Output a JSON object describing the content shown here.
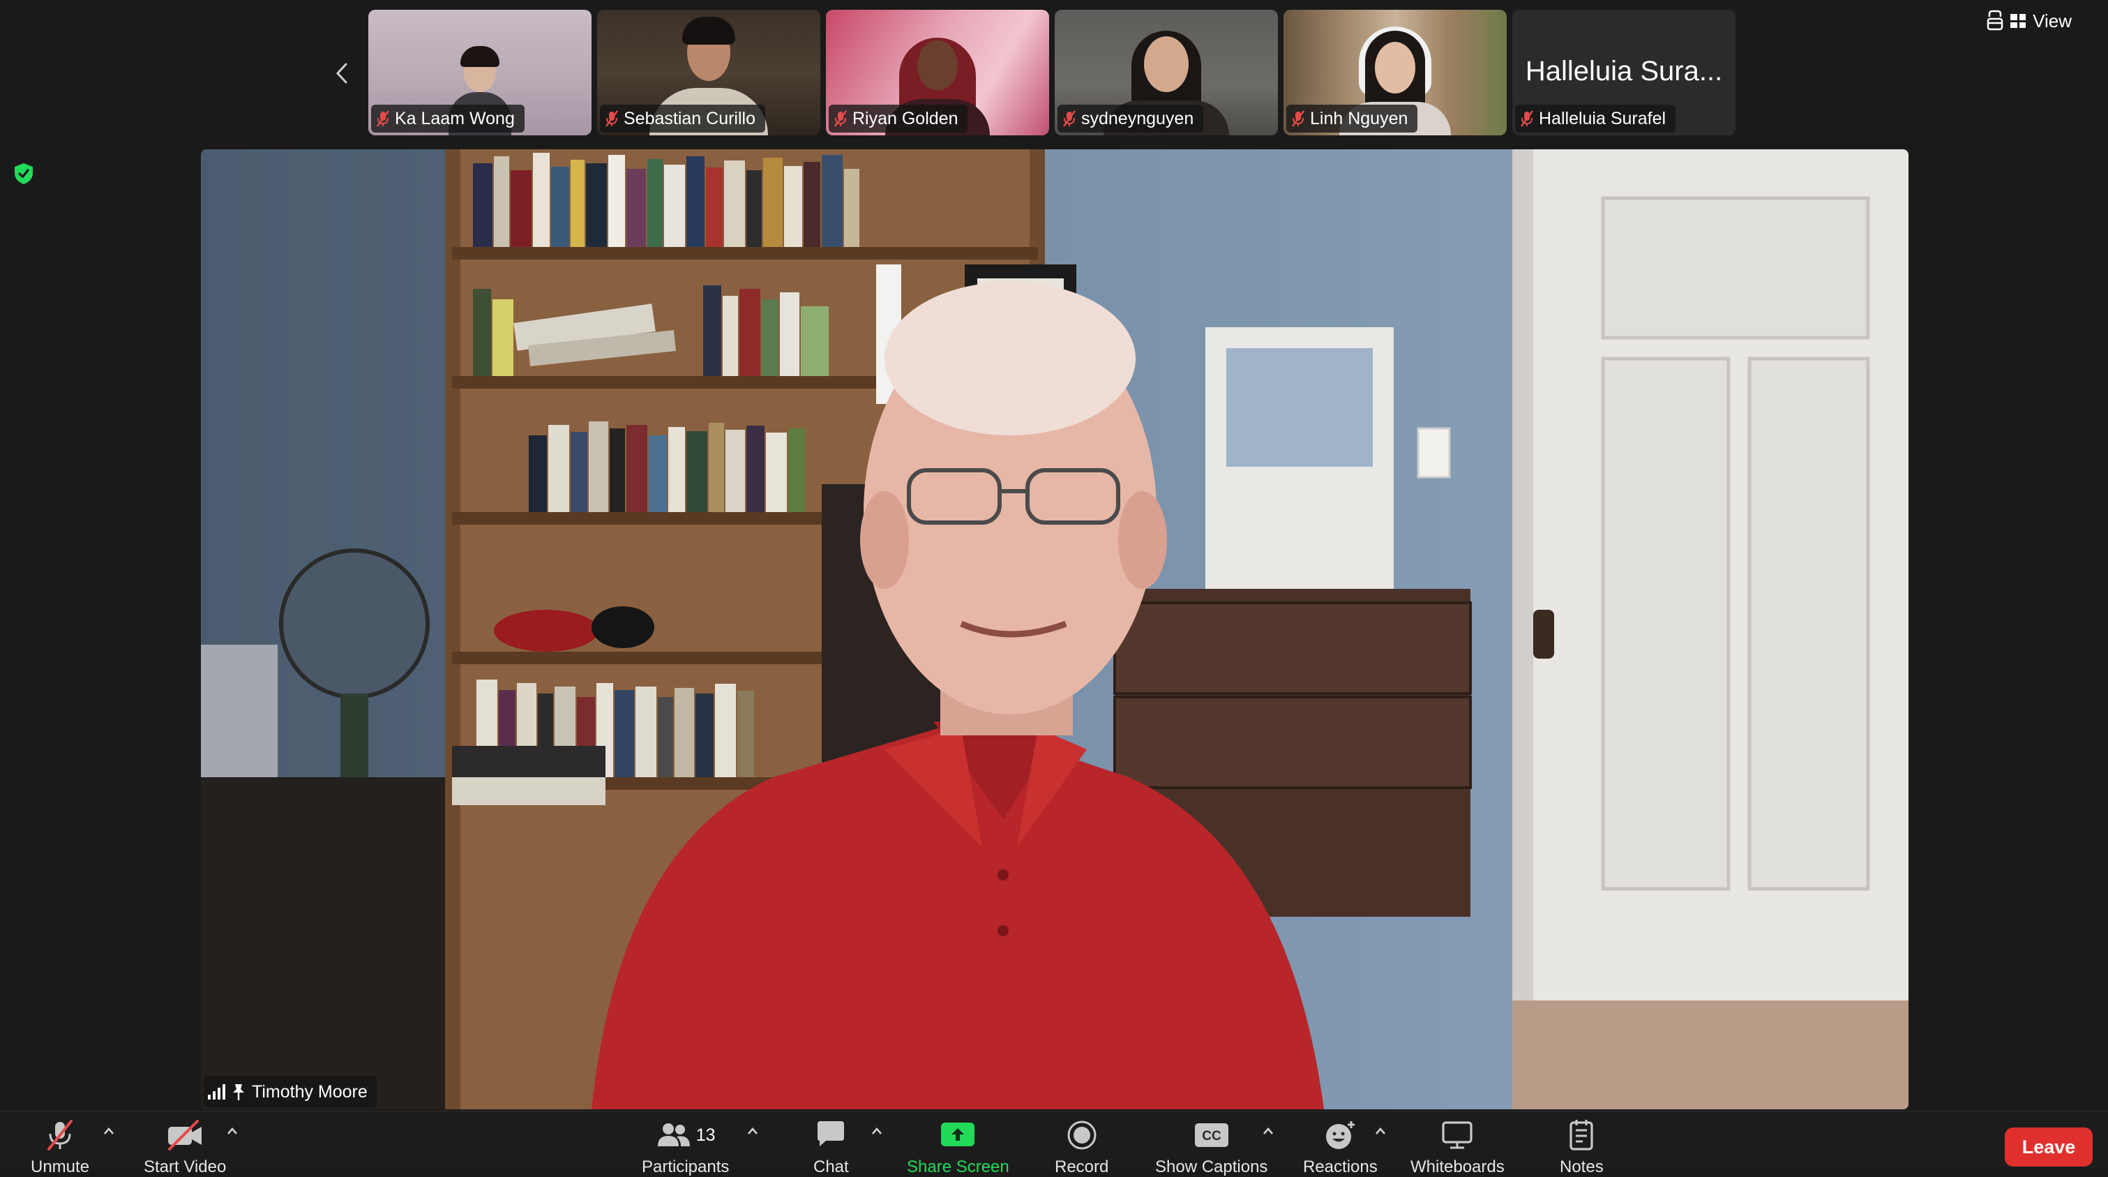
{
  "top_bar": {
    "view_label": "View",
    "view_icon": "view-grid-icon",
    "immersive_icon": "immersive-view-icon"
  },
  "filmstrip": {
    "prev_icon": "chevron-left-icon",
    "participants": [
      {
        "name": "Ka Laam Wong",
        "muted": true
      },
      {
        "name": "Sebastian Curillo",
        "muted": true
      },
      {
        "name": "Riyan Golden",
        "muted": true
      },
      {
        "name": "sydneynguyen",
        "muted": true
      },
      {
        "name": "Linh Nguyen",
        "muted": true
      },
      {
        "name": "Halleluia Surafel",
        "display_title": "Halleluia Sura...",
        "muted": true,
        "video_off": true
      }
    ]
  },
  "security": {
    "icon": "shield-check-icon",
    "color": "#23d959"
  },
  "main_speaker": {
    "name": "Timothy Moore",
    "pinned": true
  },
  "toolbar": {
    "unmute_label": "Unmute",
    "start_video_label": "Start Video",
    "participants_label": "Participants",
    "participants_count": "13",
    "chat_label": "Chat",
    "share_screen_label": "Share Screen",
    "record_label": "Record",
    "show_captions_label": "Show Captions",
    "captions_badge": "CC",
    "reactions_label": "Reactions",
    "whiteboards_label": "Whiteboards",
    "notes_label": "Notes",
    "leave_label": "Leave"
  },
  "colors": {
    "share_green": "#23d959",
    "leave_red": "#e0302e",
    "muted_red": "#e34a4a",
    "background": "#1a1a1a"
  }
}
